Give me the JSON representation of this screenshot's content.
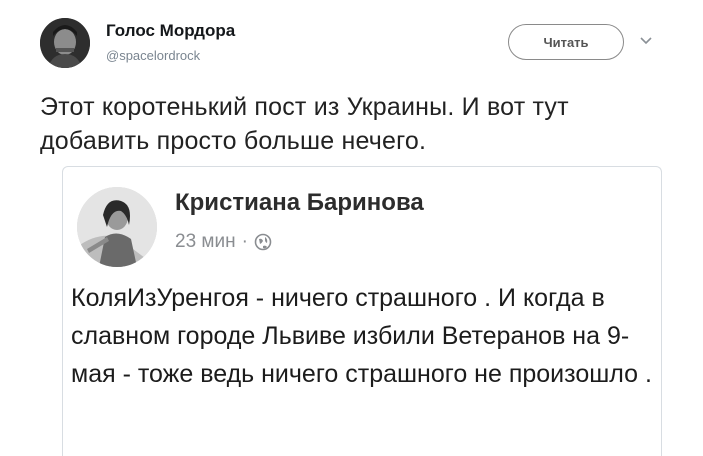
{
  "tweet": {
    "author_name": "Голос Мордора",
    "author_handle": "@spacelordrock",
    "follow_label": "Читать",
    "text": "Этот коротенький пост из Украины. И вот тут добавить просто больше нечего."
  },
  "quoted_post": {
    "author_name": "Кристиана Баринова",
    "time": "23 мин",
    "separator": "·",
    "text": "КоляИзУренгоя - ничего страшного . И когда в славном городе Львиве избили Ветеранов на 9-мая - тоже ведь ничего страшного не произошло ."
  },
  "icons": {
    "menu": "chevron-down-icon",
    "privacy": "globe-icon"
  }
}
